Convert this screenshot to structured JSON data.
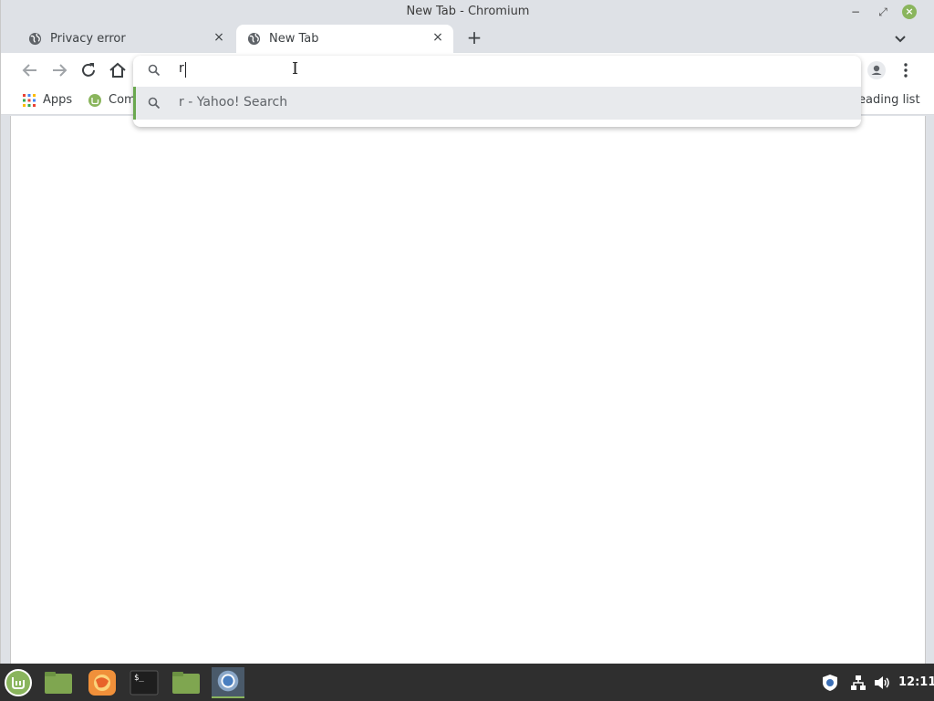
{
  "window": {
    "title": "New Tab - Chromium",
    "minimize_glyph": "−",
    "maximize_glyph": "⤢",
    "close_glyph": "×"
  },
  "tabs": [
    {
      "title": "Privacy error",
      "icon": "globe-icon",
      "active": false,
      "close_glyph": "×"
    },
    {
      "title": "New Tab",
      "icon": "globe-icon",
      "active": true,
      "close_glyph": "×"
    }
  ],
  "tabstrip": {
    "new_tab_glyph": "+"
  },
  "bookmarks": {
    "apps_label": "Apps",
    "item_label": "Com",
    "reading_list_label": "eading list"
  },
  "omnibox": {
    "input_value": "r",
    "suggestion": "r - Yahoo! Search",
    "highlight_color": "#6aa84f"
  },
  "taskbar": {
    "clock": "12:11",
    "items": [
      "mint-menu-icon",
      "files-icon",
      "firefox-icon",
      "terminal-icon",
      "files-icon",
      "chromium-icon"
    ]
  },
  "colors": {
    "accent": "#8ab55d",
    "taskbar_bg": "#2f2f2f",
    "chrome_frame": "#dee1e6"
  }
}
